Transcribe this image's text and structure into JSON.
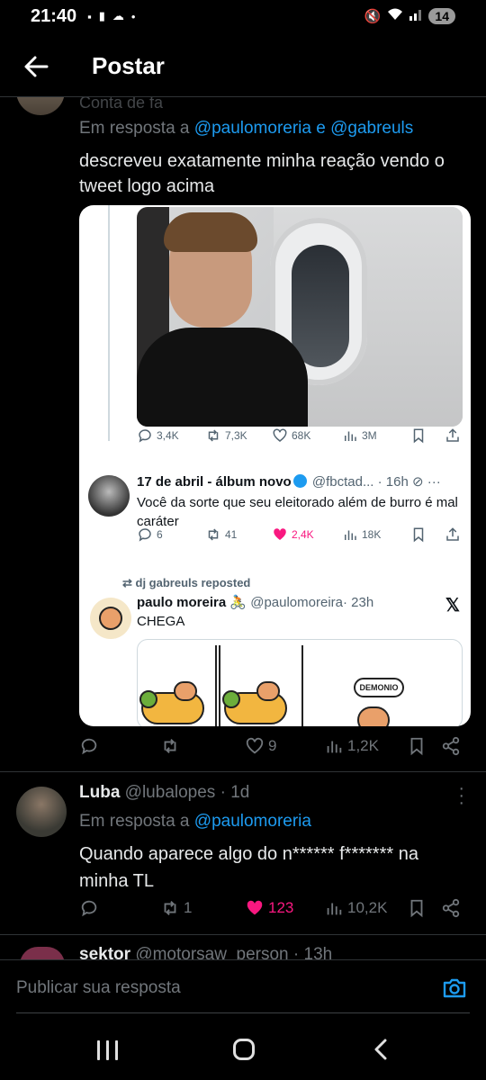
{
  "status_bar": {
    "time": "21:40",
    "battery": "14"
  },
  "header": {
    "title": "Postar"
  },
  "main_tweet": {
    "community_label": "Conta de fa",
    "reply_prefix": "Em resposta a",
    "reply_mentions": "@paulomoreria e @gabreuls",
    "text": "descreveu exatamente minha reação vendo o tweet logo acima",
    "actions": {
      "replies": "",
      "reposts": "",
      "likes": "9",
      "views": "1,2K"
    }
  },
  "embedded": {
    "photo_metrics": {
      "replies": "3,4K",
      "reposts": "7,3K",
      "likes": "68K",
      "views": "3M"
    },
    "tweet2": {
      "name": "17 de abril - álbum novo",
      "handle": "@fbctad...",
      "time": "· 16h",
      "text": "Você da sorte que seu eleitorado além de burro é mal caráter",
      "metrics": {
        "replies": "6",
        "reposts": "41",
        "likes": "2,4K",
        "views": "18K"
      }
    },
    "repost_label": "dj gabreuls reposted",
    "tweet3": {
      "name": "paulo moreira 🚴",
      "handle": "@paulomoreira",
      "time": "· 23h",
      "text": "CHEGA",
      "comic_bubble": "DEMONIO"
    }
  },
  "reply1": {
    "name": "Luba",
    "handle": "@lubalopes",
    "time": "· 1d",
    "reply_prefix": "Em resposta a",
    "reply_mention": "@paulomoreria",
    "text": "Quando aparece algo do n****** f******* na minha TL",
    "actions": {
      "reposts": "1",
      "likes": "123",
      "views": "10,2K"
    }
  },
  "reply2": {
    "name": "sektor",
    "handle": "@motorsaw_person",
    "time": "· 13h"
  },
  "composer": {
    "placeholder": "Publicar sua resposta"
  },
  "colors": {
    "accent": "#1d9bf0",
    "like": "#f91880",
    "muted": "#71767b",
    "background": "#000000"
  }
}
